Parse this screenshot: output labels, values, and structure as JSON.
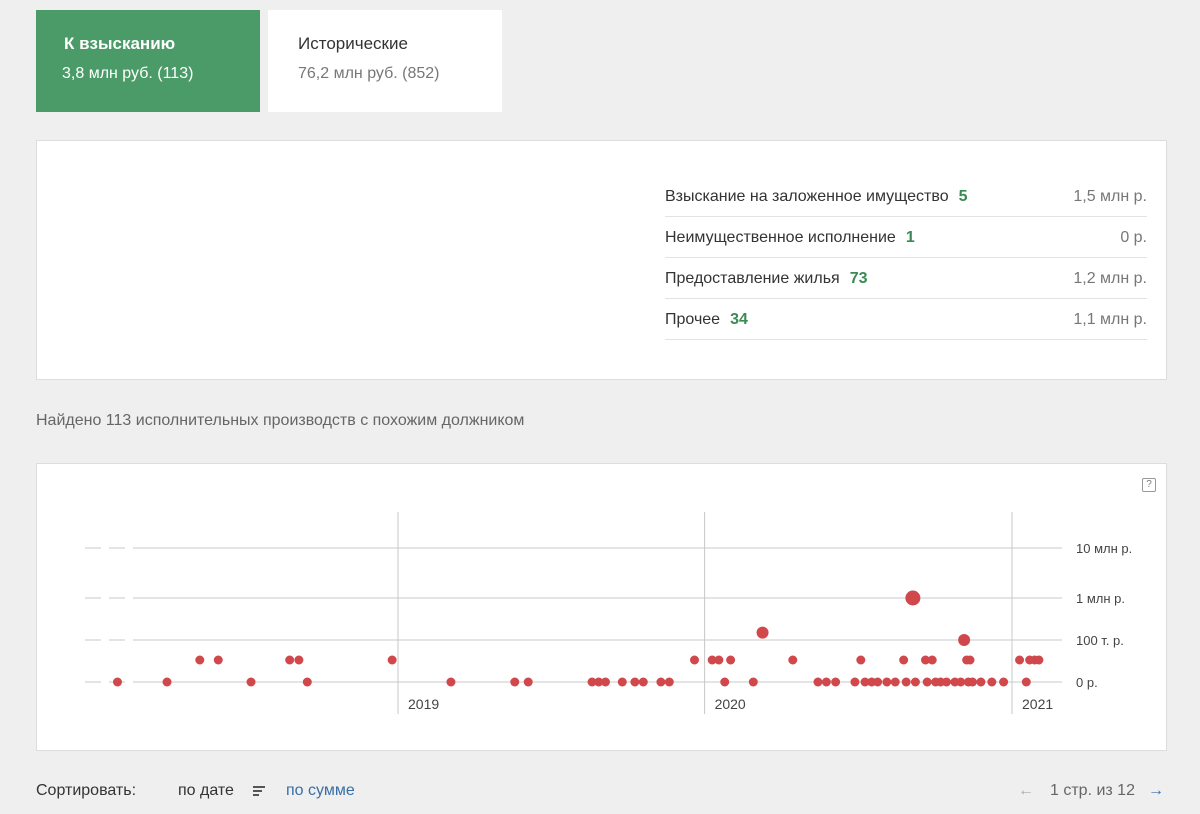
{
  "tabs": [
    {
      "title": "К взысканию",
      "subtitle": "3,8 млн руб. (113)",
      "active": true
    },
    {
      "title": "Исторические",
      "subtitle": "76,2 млн руб. (852)",
      "active": false
    }
  ],
  "summary": {
    "rows": [
      {
        "label": "Взыскание на заложенное имущество",
        "count": "5",
        "amount": "1,5 млн р."
      },
      {
        "label": "Неимущественное исполнение",
        "count": "1",
        "amount": "0 р."
      },
      {
        "label": "Предоставление жилья",
        "count": "73",
        "amount": "1,2 млн р."
      },
      {
        "label": "Прочее",
        "count": "34",
        "amount": "1,1 млн р."
      }
    ]
  },
  "found_text": "Найдено 113 исполнительных производств с похожим должником",
  "help_icon": "?",
  "chart_data": {
    "type": "scatter",
    "title": "",
    "xlabel": "",
    "ylabel": "",
    "x_tick_labels": [
      "2019",
      "2020",
      "2021"
    ],
    "x_range": [
      "2018-01",
      "2021-03"
    ],
    "y_scale": "log-like",
    "y_tick_labels": [
      "10 млн р.",
      "1 млн р.",
      "100 т. р.",
      "0 р."
    ],
    "color": "#d0484b",
    "grid": true,
    "points": [
      {
        "x": "2018-02-01",
        "y": 0
      },
      {
        "x": "2018-04-01",
        "y": 0
      },
      {
        "x": "2018-05-10",
        "y": 30000
      },
      {
        "x": "2018-06-01",
        "y": 30000
      },
      {
        "x": "2018-07-10",
        "y": 0
      },
      {
        "x": "2018-08-25",
        "y": 30000
      },
      {
        "x": "2018-09-05",
        "y": 30000
      },
      {
        "x": "2018-09-15",
        "y": 0
      },
      {
        "x": "2018-12-25",
        "y": 30000
      },
      {
        "x": "2019-03-05",
        "y": 0
      },
      {
        "x": "2019-05-20",
        "y": 0
      },
      {
        "x": "2019-06-05",
        "y": 0
      },
      {
        "x": "2019-08-20",
        "y": 0
      },
      {
        "x": "2019-08-28",
        "y": 0
      },
      {
        "x": "2019-09-05",
        "y": 0
      },
      {
        "x": "2019-09-25",
        "y": 0
      },
      {
        "x": "2019-10-10",
        "y": 0
      },
      {
        "x": "2019-10-20",
        "y": 0
      },
      {
        "x": "2019-11-10",
        "y": 0
      },
      {
        "x": "2019-11-20",
        "y": 0
      },
      {
        "x": "2019-12-20",
        "y": 30000
      },
      {
        "x": "2020-01-10",
        "y": 30000
      },
      {
        "x": "2020-01-18",
        "y": 30000
      },
      {
        "x": "2020-01-25",
        "y": 0
      },
      {
        "x": "2020-02-01",
        "y": 30000
      },
      {
        "x": "2020-02-28",
        "y": 0
      },
      {
        "x": "2020-03-10",
        "y": 150000
      },
      {
        "x": "2020-04-15",
        "y": 30000
      },
      {
        "x": "2020-05-15",
        "y": 0
      },
      {
        "x": "2020-05-25",
        "y": 0
      },
      {
        "x": "2020-06-05",
        "y": 0
      },
      {
        "x": "2020-06-28",
        "y": 0
      },
      {
        "x": "2020-07-05",
        "y": 30000
      },
      {
        "x": "2020-07-10",
        "y": 0
      },
      {
        "x": "2020-07-18",
        "y": 0
      },
      {
        "x": "2020-07-25",
        "y": 0
      },
      {
        "x": "2020-08-05",
        "y": 0
      },
      {
        "x": "2020-08-15",
        "y": 0
      },
      {
        "x": "2020-08-25",
        "y": 30000
      },
      {
        "x": "2020-08-28",
        "y": 0
      },
      {
        "x": "2020-09-05",
        "y": 1000000
      },
      {
        "x": "2020-09-08",
        "y": 0
      },
      {
        "x": "2020-09-20",
        "y": 30000
      },
      {
        "x": "2020-09-22",
        "y": 0
      },
      {
        "x": "2020-09-28",
        "y": 30000
      },
      {
        "x": "2020-10-02",
        "y": 0
      },
      {
        "x": "2020-10-08",
        "y": 0
      },
      {
        "x": "2020-10-15",
        "y": 0
      },
      {
        "x": "2020-10-25",
        "y": 0
      },
      {
        "x": "2020-11-01",
        "y": 0
      },
      {
        "x": "2020-11-05",
        "y": 100000
      },
      {
        "x": "2020-11-08",
        "y": 30000
      },
      {
        "x": "2020-11-10",
        "y": 0
      },
      {
        "x": "2020-11-12",
        "y": 30000
      },
      {
        "x": "2020-11-15",
        "y": 0
      },
      {
        "x": "2020-11-25",
        "y": 0
      },
      {
        "x": "2020-12-08",
        "y": 0
      },
      {
        "x": "2020-12-22",
        "y": 0
      },
      {
        "x": "2021-01-10",
        "y": 30000
      },
      {
        "x": "2021-01-18",
        "y": 0
      },
      {
        "x": "2021-01-22",
        "y": 30000
      },
      {
        "x": "2021-01-28",
        "y": 30000
      },
      {
        "x": "2021-02-02",
        "y": 30000
      }
    ]
  },
  "footer": {
    "sort_label": "Сортировать:",
    "by_date": "по дате",
    "by_sum": "по сумме",
    "prev_arrow": "←",
    "pages": "1 стр. из 12",
    "next_arrow": "→"
  }
}
